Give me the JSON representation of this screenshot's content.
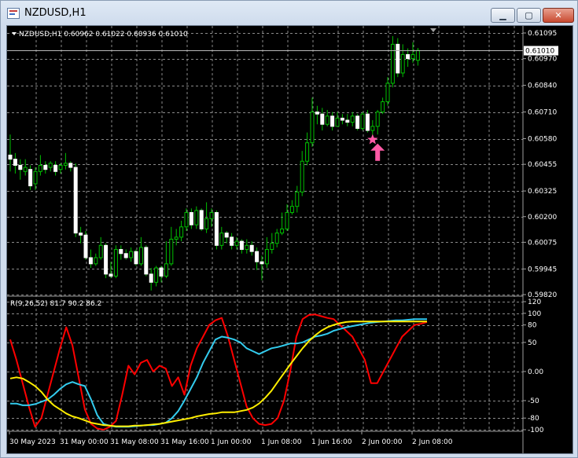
{
  "window": {
    "title": "NZDUSD,H1",
    "minimize_glyph": "▁",
    "maximize_glyph": "▢",
    "close_glyph": "✕"
  },
  "colors": {
    "background": "#000000",
    "grid": "#8a8a8a",
    "bull_wick": "#00c000",
    "bear_candle": "#ffffff",
    "bull_candle": "#000000",
    "series_red": "#ff0000",
    "series_cyan": "#33ccee",
    "series_yellow": "#ffee00",
    "marker": "#ff5aa6"
  },
  "icons": {
    "marker_star": "star-icon",
    "marker_arrow": "up-arrow-icon",
    "dropdown": "triangle-down-icon"
  },
  "chart_data": [
    {
      "type": "candlestick",
      "header": "NZDUSD,H1  0.60962 0.61022 0.60936 0.61010",
      "current_price_label": "0.61010",
      "y_ticks": [
        "0.61095",
        "0.60970",
        "0.60840",
        "0.60710",
        "0.60580",
        "0.60455",
        "0.60325",
        "0.60200",
        "0.60075",
        "0.59945",
        "0.59820"
      ],
      "y_range": [
        0.5982,
        0.61095
      ],
      "x_tick_labels": [
        "30 May 2023",
        "31 May 00:00",
        "31 May 08:00",
        "31 May 16:00",
        "1 Jun 00:00",
        "1 Jun 08:00",
        "1 Jun 16:00",
        "2 Jun 00:00",
        "2 Jun 08:00"
      ],
      "candles": [
        [
          0.605,
          0.6048,
          0.606,
          0.6042
        ],
        [
          0.6048,
          0.6045,
          0.6051,
          0.6041
        ],
        [
          0.6045,
          0.6043,
          0.6048,
          0.6038
        ],
        [
          0.6042,
          0.6044,
          0.6048,
          0.604
        ],
        [
          0.6043,
          0.6035,
          0.6045,
          0.6033
        ],
        [
          0.6036,
          0.6042,
          0.6044,
          0.6033
        ],
        [
          0.6042,
          0.6045,
          0.605,
          0.604
        ],
        [
          0.6045,
          0.6043,
          0.6047,
          0.6041
        ],
        [
          0.6044,
          0.6046,
          0.6047,
          0.6042
        ],
        [
          0.6045,
          0.6042,
          0.6047,
          0.604
        ],
        [
          0.6043,
          0.6045,
          0.6046,
          0.6041
        ],
        [
          0.6045,
          0.6046,
          0.6051,
          0.6043
        ],
        [
          0.6046,
          0.6044,
          0.6047,
          0.6042
        ],
        [
          0.6044,
          0.6012,
          0.6046,
          0.601
        ],
        [
          0.6012,
          0.6011,
          0.6015,
          0.6007
        ],
        [
          0.6011,
          0.6,
          0.6013,
          0.5999
        ],
        [
          0.6,
          0.5997,
          0.6004,
          0.5995
        ],
        [
          0.5997,
          0.6,
          0.6002,
          0.5996
        ],
        [
          0.6,
          0.6006,
          0.601,
          0.5999
        ],
        [
          0.6006,
          0.5992,
          0.6007,
          0.599
        ],
        [
          0.5992,
          0.5991,
          0.5998,
          0.599
        ],
        [
          0.5991,
          0.6004,
          0.6006,
          0.599
        ],
        [
          0.6004,
          0.6002,
          0.6006,
          0.5999
        ],
        [
          0.6002,
          0.6,
          0.6004,
          0.5999
        ],
        [
          0.6,
          0.6003,
          0.6005,
          0.5998
        ],
        [
          0.6003,
          0.5997,
          0.6004,
          0.5996
        ],
        [
          0.5997,
          0.6005,
          0.601,
          0.5996
        ],
        [
          0.6005,
          0.5992,
          0.6006,
          0.5991
        ],
        [
          0.5992,
          0.5988,
          0.5995,
          0.5984
        ],
        [
          0.5988,
          0.5995,
          0.5996,
          0.5986
        ],
        [
          0.5995,
          0.5991,
          0.5996,
          0.5988
        ],
        [
          0.5991,
          0.5997,
          0.6008,
          0.599
        ],
        [
          0.5997,
          0.6009,
          0.6015,
          0.5996
        ],
        [
          0.6009,
          0.601,
          0.6014,
          0.6006
        ],
        [
          0.601,
          0.6015,
          0.6018,
          0.6008
        ],
        [
          0.6015,
          0.6022,
          0.6024,
          0.6013
        ],
        [
          0.6022,
          0.6016,
          0.6024,
          0.6014
        ],
        [
          0.6016,
          0.6023,
          0.6025,
          0.6014
        ],
        [
          0.6023,
          0.6014,
          0.6024,
          0.6013
        ],
        [
          0.6014,
          0.6019,
          0.6027,
          0.6012
        ],
        [
          0.6019,
          0.6022,
          0.6024,
          0.6015
        ],
        [
          0.6022,
          0.6006,
          0.6023,
          0.6004
        ],
        [
          0.6006,
          0.6012,
          0.6015,
          0.6004
        ],
        [
          0.6012,
          0.601,
          0.6013,
          0.6007
        ],
        [
          0.601,
          0.6006,
          0.6012,
          0.6004
        ],
        [
          0.6006,
          0.6008,
          0.601,
          0.6004
        ],
        [
          0.6008,
          0.6004,
          0.6009,
          0.6002
        ],
        [
          0.6004,
          0.6006,
          0.6009,
          0.6002
        ],
        [
          0.6006,
          0.6003,
          0.6008,
          0.6001
        ],
        [
          0.6003,
          0.5998,
          0.6005,
          0.5994
        ],
        [
          0.5998,
          0.5997,
          0.6001,
          0.5989
        ],
        [
          0.5997,
          0.6004,
          0.601,
          0.5995
        ],
        [
          0.6004,
          0.6007,
          0.6012,
          0.6002
        ],
        [
          0.6007,
          0.6012,
          0.6014,
          0.6005
        ],
        [
          0.6012,
          0.6014,
          0.6022,
          0.6011
        ],
        [
          0.6014,
          0.6022,
          0.6026,
          0.6013
        ],
        [
          0.6022,
          0.6025,
          0.6028,
          0.6021
        ],
        [
          0.6025,
          0.6032,
          0.6035,
          0.6022
        ],
        [
          0.6032,
          0.6047,
          0.6052,
          0.603
        ],
        [
          0.6047,
          0.6056,
          0.6061,
          0.6045
        ],
        [
          0.6056,
          0.6071,
          0.6078,
          0.6054
        ],
        [
          0.6071,
          0.607,
          0.6074,
          0.6065
        ],
        [
          0.607,
          0.6065,
          0.6073,
          0.6062
        ],
        [
          0.6065,
          0.6069,
          0.6072,
          0.6064
        ],
        [
          0.6069,
          0.6064,
          0.6071,
          0.6062
        ],
        [
          0.6064,
          0.6068,
          0.6071,
          0.6064
        ],
        [
          0.6068,
          0.6067,
          0.607,
          0.6065
        ],
        [
          0.6067,
          0.6066,
          0.607,
          0.6064
        ],
        [
          0.6066,
          0.6069,
          0.6071,
          0.6064
        ],
        [
          0.6069,
          0.6063,
          0.607,
          0.6062
        ],
        [
          0.6063,
          0.607,
          0.6071,
          0.6062
        ],
        [
          0.607,
          0.6062,
          0.6072,
          0.6061
        ],
        [
          0.6062,
          0.6064,
          0.6067,
          0.6059
        ],
        [
          0.6064,
          0.6071,
          0.6072,
          0.606
        ],
        [
          0.6071,
          0.6076,
          0.6078,
          0.607
        ],
        [
          0.6076,
          0.6085,
          0.6088,
          0.6074
        ],
        [
          0.6085,
          0.6104,
          0.6108,
          0.6083
        ],
        [
          0.6104,
          0.609,
          0.6107,
          0.6088
        ],
        [
          0.609,
          0.6099,
          0.6104,
          0.6088
        ],
        [
          0.6099,
          0.6097,
          0.6102,
          0.6093
        ],
        [
          0.6097,
          0.6099,
          0.6105,
          0.6095
        ],
        [
          0.60962,
          0.6101,
          0.61022,
          0.60936
        ]
      ],
      "markers": [
        {
          "icon": "star",
          "candle": 72,
          "price": 0.60575
        },
        {
          "icon": "up-arrow",
          "candle": 73,
          "price": 0.6051
        }
      ]
    },
    {
      "type": "line",
      "header": "R(9,26,52) 81.7 90.2 86.2",
      "y_ticks": [
        "120",
        "100",
        "80",
        "50",
        "0.00",
        "-50",
        "-80",
        "-100"
      ],
      "y_range": [
        -100,
        120
      ],
      "series": [
        {
          "color": "#ff0000",
          "values": [
            55,
            20,
            -20,
            -60,
            -95,
            -80,
            -40,
            0,
            40,
            76,
            45,
            -10,
            -65,
            -90,
            -98,
            -100,
            -95,
            -85,
            -40,
            10,
            -5,
            15,
            20,
            0,
            10,
            5,
            -25,
            -10,
            -40,
            10,
            40,
            60,
            80,
            88,
            92,
            60,
            20,
            -20,
            -60,
            -80,
            -90,
            -92,
            -90,
            -80,
            -50,
            0,
            60,
            90,
            97,
            98,
            95,
            92,
            90,
            80,
            70,
            60,
            40,
            20,
            -20,
            -20,
            0,
            20,
            40,
            60,
            70,
            80,
            82,
            85
          ]
        },
        {
          "color": "#33ccee",
          "values": [
            -55,
            -55,
            -58,
            -58,
            -56,
            -52,
            -48,
            -40,
            -30,
            -22,
            -18,
            -22,
            -25,
            -48,
            -75,
            -90,
            -93,
            -95,
            -95,
            -95,
            -94,
            -93,
            -92,
            -92,
            -90,
            -88,
            -80,
            -68,
            -50,
            -30,
            -10,
            15,
            35,
            55,
            60,
            58,
            55,
            50,
            40,
            35,
            30,
            35,
            40,
            42,
            45,
            48,
            48,
            50,
            55,
            60,
            62,
            65,
            70,
            73,
            76,
            78,
            80,
            82,
            84,
            85,
            86,
            87,
            88,
            88,
            89,
            90,
            90,
            90
          ]
        },
        {
          "color": "#ffee00",
          "values": [
            -12,
            -10,
            -12,
            -18,
            -25,
            -35,
            -48,
            -58,
            -65,
            -72,
            -77,
            -80,
            -84,
            -88,
            -90,
            -92,
            -93,
            -94,
            -94,
            -94,
            -93,
            -93,
            -92,
            -91,
            -90,
            -88,
            -86,
            -84,
            -82,
            -80,
            -77,
            -75,
            -73,
            -72,
            -70,
            -70,
            -70,
            -68,
            -66,
            -62,
            -55,
            -45,
            -33,
            -18,
            -3,
            12,
            26,
            40,
            52,
            62,
            70,
            76,
            80,
            83,
            85,
            86,
            86,
            86,
            86,
            86,
            86,
            86,
            86,
            86,
            86,
            86,
            86,
            86
          ]
        }
      ]
    }
  ]
}
